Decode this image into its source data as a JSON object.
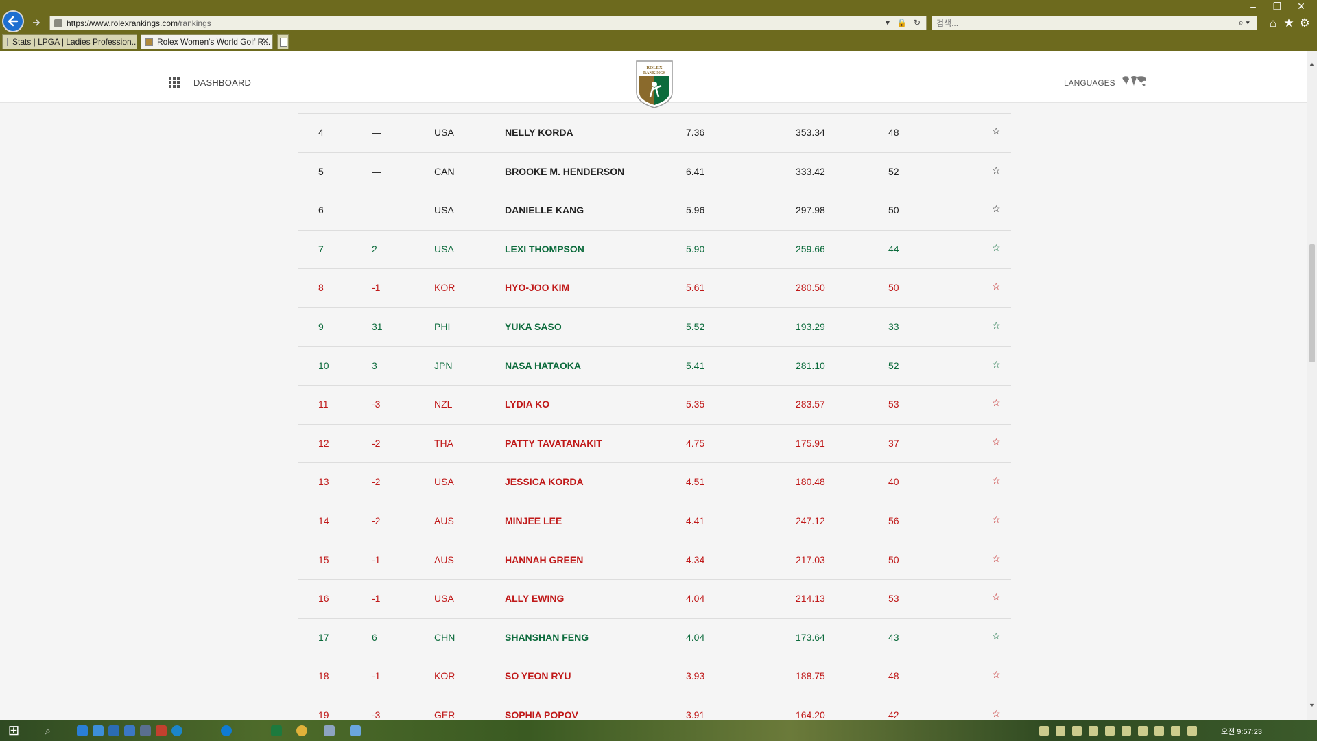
{
  "browser": {
    "url_prefix": "https://www.rolexrankings.com",
    "url_path": "/rankings",
    "search_placeholder": "검색...",
    "tabs": [
      {
        "label": "Stats | LPGA | Ladies Profession..."
      },
      {
        "label": "Rolex Women's World Golf R..."
      }
    ]
  },
  "header": {
    "dashboard_label": "DASHBOARD",
    "logo_text_1": "ROLEX",
    "logo_text_2": "RANKINGS",
    "languages_label": "LANGUAGES"
  },
  "rows": [
    {
      "rank": "4",
      "move": "—",
      "country": "USA",
      "name": "NELLY KORDA",
      "avg": "7.36",
      "total": "353.34",
      "events": "48",
      "trend": "neutral"
    },
    {
      "rank": "5",
      "move": "—",
      "country": "CAN",
      "name": "BROOKE M. HENDERSON",
      "avg": "6.41",
      "total": "333.42",
      "events": "52",
      "trend": "neutral"
    },
    {
      "rank": "6",
      "move": "—",
      "country": "USA",
      "name": "DANIELLE KANG",
      "avg": "5.96",
      "total": "297.98",
      "events": "50",
      "trend": "neutral"
    },
    {
      "rank": "7",
      "move": "2",
      "country": "USA",
      "name": "LEXI THOMPSON",
      "avg": "5.90",
      "total": "259.66",
      "events": "44",
      "trend": "up"
    },
    {
      "rank": "8",
      "move": "-1",
      "country": "KOR",
      "name": "HYO-JOO KIM",
      "avg": "5.61",
      "total": "280.50",
      "events": "50",
      "trend": "down"
    },
    {
      "rank": "9",
      "move": "31",
      "country": "PHI",
      "name": "YUKA SASO",
      "avg": "5.52",
      "total": "193.29",
      "events": "33",
      "trend": "up"
    },
    {
      "rank": "10",
      "move": "3",
      "country": "JPN",
      "name": "NASA HATAOKA",
      "avg": "5.41",
      "total": "281.10",
      "events": "52",
      "trend": "up"
    },
    {
      "rank": "11",
      "move": "-3",
      "country": "NZL",
      "name": "LYDIA KO",
      "avg": "5.35",
      "total": "283.57",
      "events": "53",
      "trend": "down"
    },
    {
      "rank": "12",
      "move": "-2",
      "country": "THA",
      "name": "PATTY TAVATANAKIT",
      "avg": "4.75",
      "total": "175.91",
      "events": "37",
      "trend": "down"
    },
    {
      "rank": "13",
      "move": "-2",
      "country": "USA",
      "name": "JESSICA KORDA",
      "avg": "4.51",
      "total": "180.48",
      "events": "40",
      "trend": "down"
    },
    {
      "rank": "14",
      "move": "-2",
      "country": "AUS",
      "name": "MINJEE LEE",
      "avg": "4.41",
      "total": "247.12",
      "events": "56",
      "trend": "down"
    },
    {
      "rank": "15",
      "move": "-1",
      "country": "AUS",
      "name": "HANNAH GREEN",
      "avg": "4.34",
      "total": "217.03",
      "events": "50",
      "trend": "down"
    },
    {
      "rank": "16",
      "move": "-1",
      "country": "USA",
      "name": "ALLY EWING",
      "avg": "4.04",
      "total": "214.13",
      "events": "53",
      "trend": "down"
    },
    {
      "rank": "17",
      "move": "6",
      "country": "CHN",
      "name": "SHANSHAN FENG",
      "avg": "4.04",
      "total": "173.64",
      "events": "43",
      "trend": "up"
    },
    {
      "rank": "18",
      "move": "-1",
      "country": "KOR",
      "name": "SO YEON RYU",
      "avg": "3.93",
      "total": "188.75",
      "events": "48",
      "trend": "down"
    },
    {
      "rank": "19",
      "move": "-3",
      "country": "GER",
      "name": "SOPHIA POPOV",
      "avg": "3.91",
      "total": "164.20",
      "events": "42",
      "trend": "down"
    }
  ],
  "star_glyph": "☆",
  "colors": {
    "up": "#0c6b3c",
    "down": "#c01919",
    "neutral": "#222222",
    "chrome": "#6d6a1e"
  },
  "taskbar": {
    "clock": "오전 9:57:23"
  }
}
